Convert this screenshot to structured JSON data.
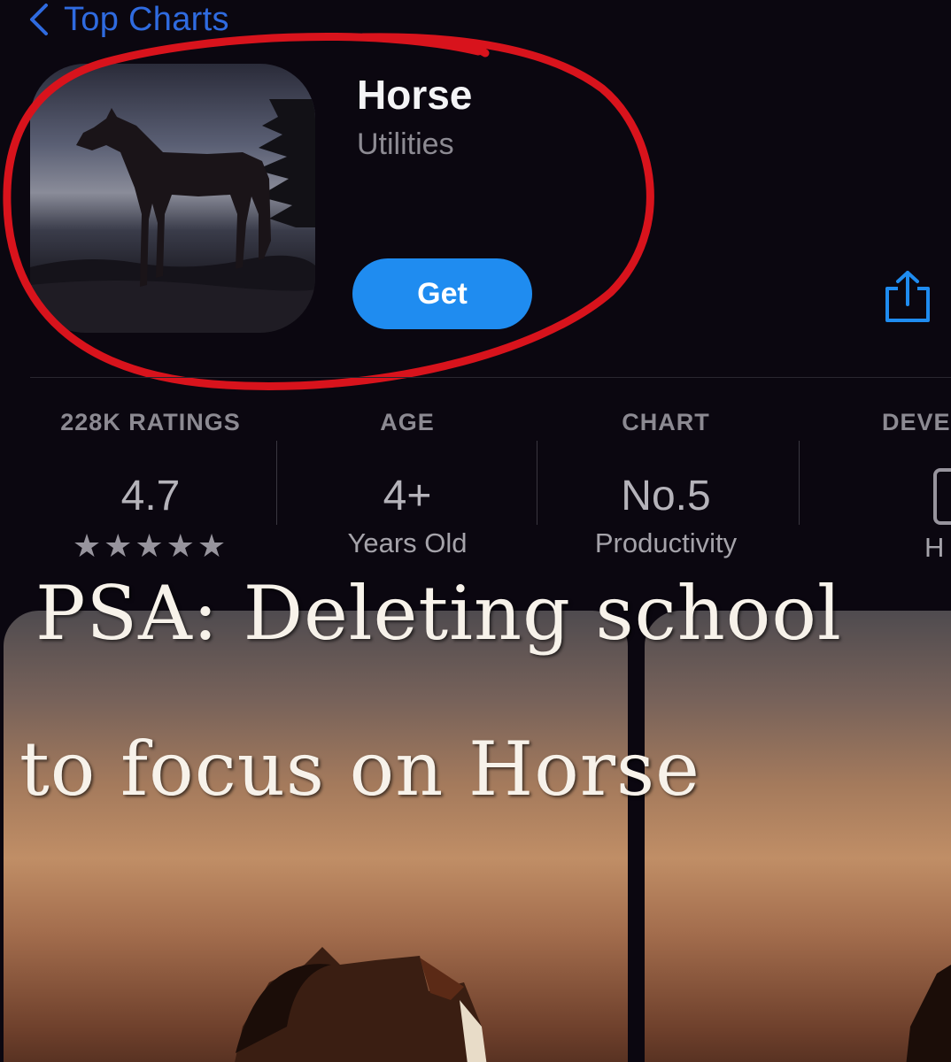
{
  "nav": {
    "back_label": "Top Charts"
  },
  "app": {
    "title": "Horse",
    "category": "Utilities",
    "get_label": "Get"
  },
  "stats": [
    {
      "header": "228K RATINGS",
      "value": "4.7",
      "detail": "★★★★★"
    },
    {
      "header": "AGE",
      "value": "4+",
      "detail": "Years Old"
    },
    {
      "header": "CHART",
      "value": "No.5",
      "detail": "Productivity"
    },
    {
      "header": "DEVE",
      "value": "",
      "detail": "H"
    }
  ],
  "meme": {
    "line1": "PSA: Deleting school",
    "line2": "to focus on Horse"
  },
  "colors": {
    "background": "#0b0710",
    "accent_blue": "#1f8cf0",
    "nav_blue": "#2f6be0",
    "annotation_red": "#d8131c"
  },
  "icons": [
    "chevron-left-icon",
    "share-icon",
    "stars-icon",
    "developer-icon"
  ]
}
